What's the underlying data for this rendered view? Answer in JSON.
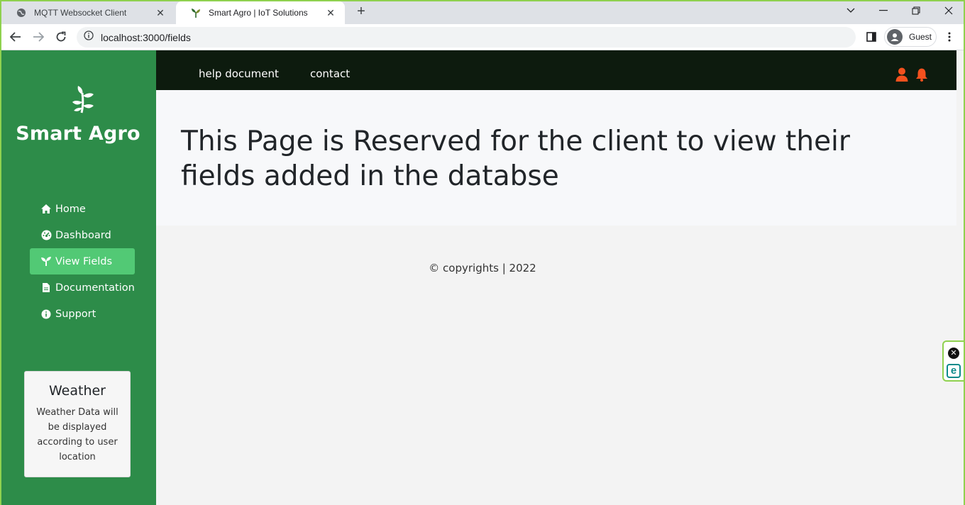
{
  "browser": {
    "tabs": [
      {
        "title": "MQTT Websocket Client",
        "close": "✕"
      },
      {
        "title": "Smart Agro | IoT Solutions",
        "close": "✕"
      }
    ],
    "new_tab": "+",
    "url": "localhost:3000/fields",
    "profile": "Guest"
  },
  "sidebar": {
    "brand": "Smart Agro",
    "items": [
      {
        "label": "Home",
        "icon": "home-icon"
      },
      {
        "label": "Dashboard",
        "icon": "gauge-icon"
      },
      {
        "label": "View Fields",
        "icon": "seedling-icon",
        "active": true
      },
      {
        "label": "Documentation",
        "icon": "file-icon"
      },
      {
        "label": "Support",
        "icon": "info-icon"
      }
    ],
    "weather": {
      "title": "Weather",
      "text": "Weather Data will be displayed according to user location"
    }
  },
  "topnav": {
    "links": [
      "help document",
      "contact"
    ],
    "accent": "#f4511e"
  },
  "main": {
    "heading": "This Page is Reserved for the client to view their fields added in the databse",
    "footer": "© copyrights | 2022"
  },
  "colors": {
    "sidebar": "#2d8c49",
    "active_item": "#52c975",
    "topnav": "#0d1b0e",
    "window_border": "#8fd14f"
  }
}
